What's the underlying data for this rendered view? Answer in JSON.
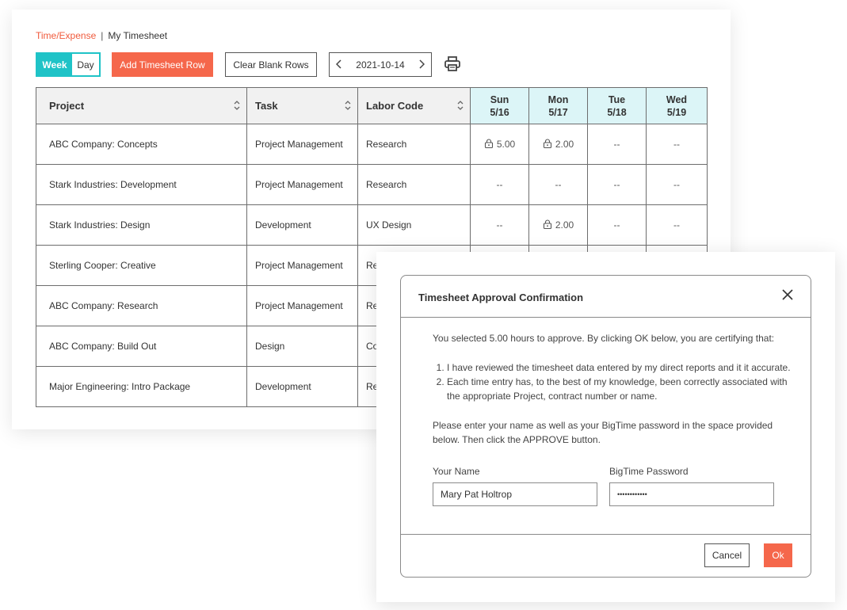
{
  "breadcrumb": {
    "section": "Time/Expense",
    "separator": "|",
    "page": "My Timesheet"
  },
  "toolbar": {
    "view_week": "Week",
    "view_day": "Day",
    "add_row": "Add Timesheet Row",
    "clear_rows": "Clear Blank Rows",
    "date": "2021-10-14",
    "print_icon": "printer-icon"
  },
  "table": {
    "headers": {
      "project": "Project",
      "task": "Task",
      "labor": "Labor Code"
    },
    "days": [
      {
        "dow": "Sun",
        "date": "5/16"
      },
      {
        "dow": "Mon",
        "date": "5/17"
      },
      {
        "dow": "Tue",
        "date": "5/18"
      },
      {
        "dow": "Wed",
        "date": "5/19"
      }
    ],
    "rows": [
      {
        "project": "ABC Company: Concepts",
        "task": "Project Management",
        "labor": "Research",
        "d0": "5.00",
        "d1": "2.00",
        "d2": "--",
        "d3": "--"
      },
      {
        "project": "Stark Industries: Development",
        "task": "Project Management",
        "labor": "Research",
        "d0": "--",
        "d1": "--",
        "d2": "--",
        "d3": "--"
      },
      {
        "project": "Stark Industries: Design",
        "task": "Development",
        "labor": "UX Design",
        "d0": "--",
        "d1": "2.00",
        "d2": "--",
        "d3": "--"
      },
      {
        "project": "Sterling Cooper: Creative",
        "task": "Project Management",
        "labor": "Re",
        "d0": "",
        "d1": "",
        "d2": "",
        "d3": ""
      },
      {
        "project": "ABC Company: Research",
        "task": "Project Management",
        "labor": "Re",
        "d0": "",
        "d1": "",
        "d2": "",
        "d3": ""
      },
      {
        "project": "ABC Company: Build Out",
        "task": "Design",
        "labor": "Co",
        "d0": "",
        "d1": "",
        "d2": "",
        "d3": ""
      },
      {
        "project": "Major Engineering: Intro Package",
        "task": "Development",
        "labor": "Re",
        "d0": "",
        "d1": "",
        "d2": "",
        "d3": ""
      }
    ]
  },
  "modal": {
    "title": "Timesheet Approval Confirmation",
    "intro": "You selected 5.00 hours to approve. By clicking OK below, you are certifying that:",
    "items": [
      "I have reviewed the timesheet data entered by my direct reports and it it accurate.",
      "Each time entry has, to the best of my knowledge, been correctly associated with the appropriate Project, contract number or name."
    ],
    "instructions": "Please enter your name as well as your BigTime password in the space provided below. Then click the APPROVE button.",
    "name_label": "Your Name",
    "name_value": "Mary Pat Holtrop",
    "password_label": "BigTime Password",
    "password_value": "••••••••••••",
    "cancel": "Cancel",
    "ok": "Ok"
  },
  "colors": {
    "accent_teal": "#1fc3c7",
    "accent_orange": "#f5674b",
    "link_orange": "#f05a3c",
    "day_header_bg": "#dcf5f7"
  }
}
